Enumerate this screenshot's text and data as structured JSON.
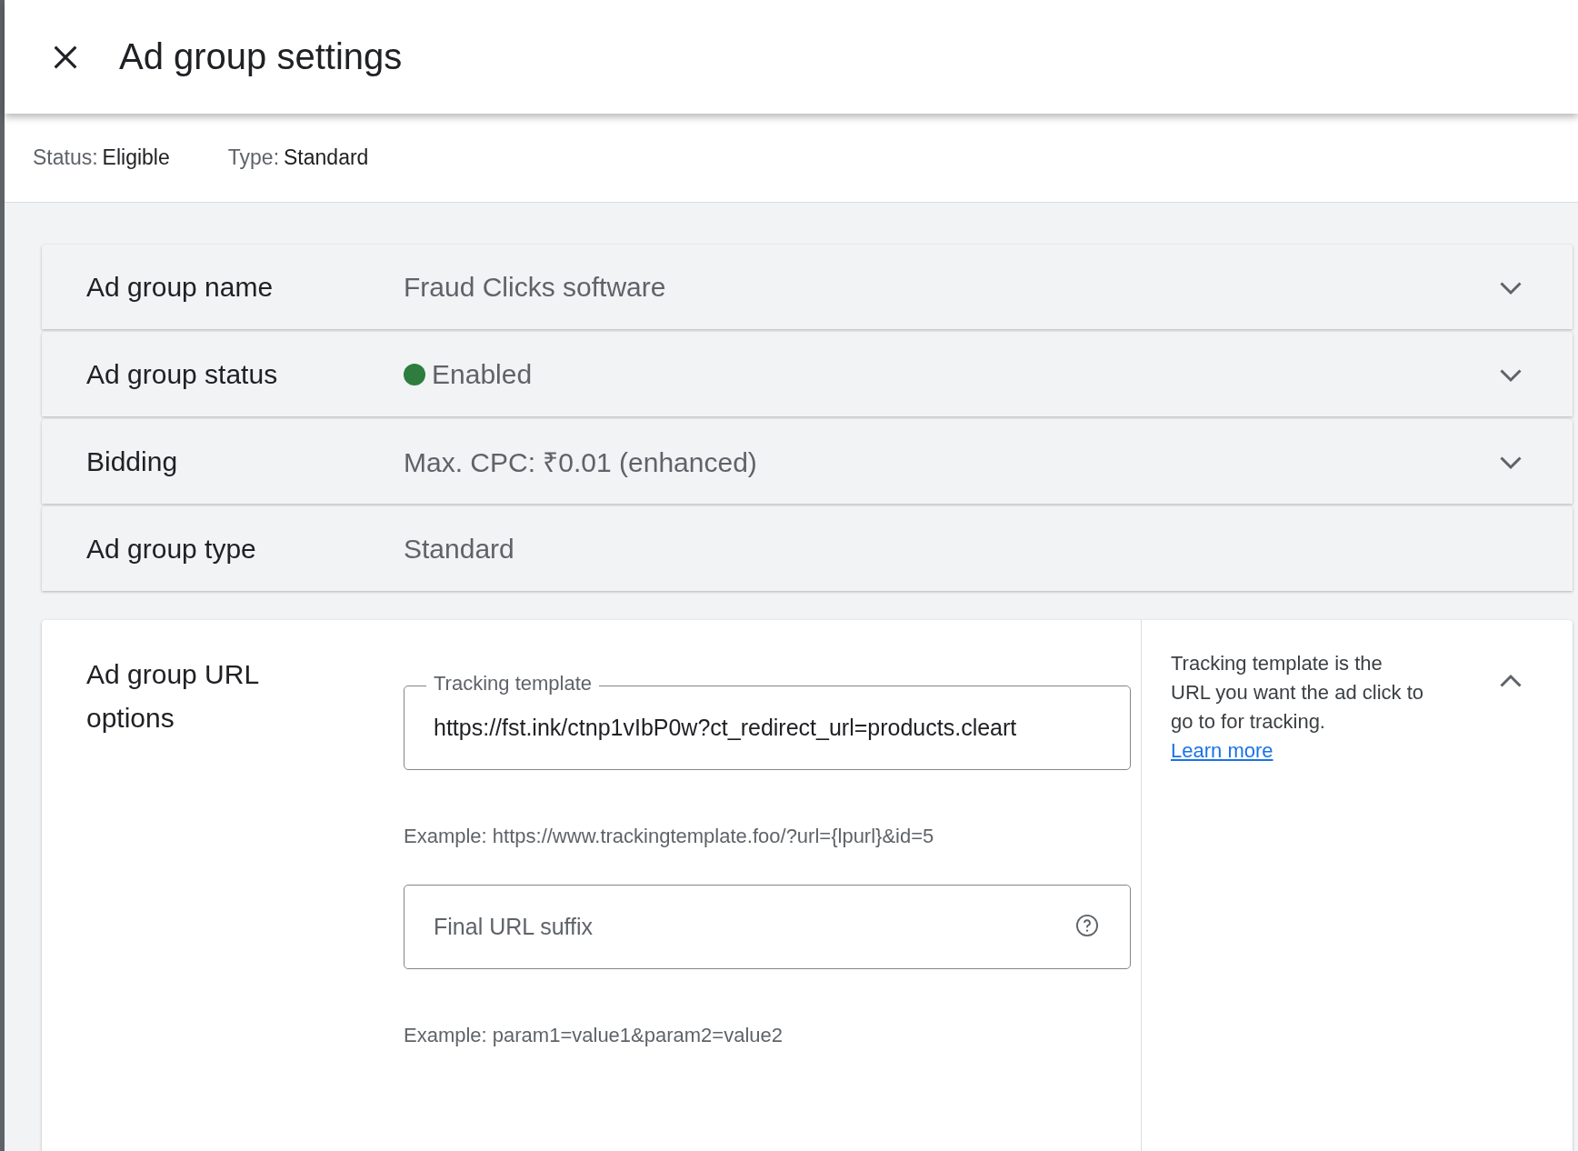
{
  "header": {
    "title": "Ad group settings"
  },
  "summary": [
    {
      "label": "Status:",
      "value": "Eligible"
    },
    {
      "label": "Type:",
      "value": "Standard"
    }
  ],
  "settings": [
    {
      "kind": "dropdown",
      "label": "Ad group name",
      "value": "Fraud Clicks software",
      "expanded": false
    },
    {
      "kind": "dropdown",
      "label": "Ad group status",
      "value": "Enabled",
      "color": "#2e7d3e",
      "expanded": false
    },
    {
      "kind": "dropdown",
      "label": "Bidding",
      "value": "Max. CPC: ₹0.01 (enhanced)",
      "expanded": false
    },
    {
      "kind": "static",
      "label": "Ad group type",
      "value": "Standard"
    }
  ],
  "url_options": {
    "label": "Ad group URL options",
    "expanded": true,
    "fields": [
      {
        "label": "Tracking template",
        "value": "https://fst.ink/ctnp1vIbP0w?ct_redirect_url=products.cleart",
        "example": "Example: https://www.trackingtemplate.foo/?url={lpurl}&id=5"
      },
      {
        "placeholder": "Final URL suffix",
        "help": true,
        "example": "Example: param1=value1&param2=value2"
      }
    ],
    "help_text": "Tracking template is the URL you want the ad click to go to for tracking.",
    "help_link": "Learn more"
  }
}
